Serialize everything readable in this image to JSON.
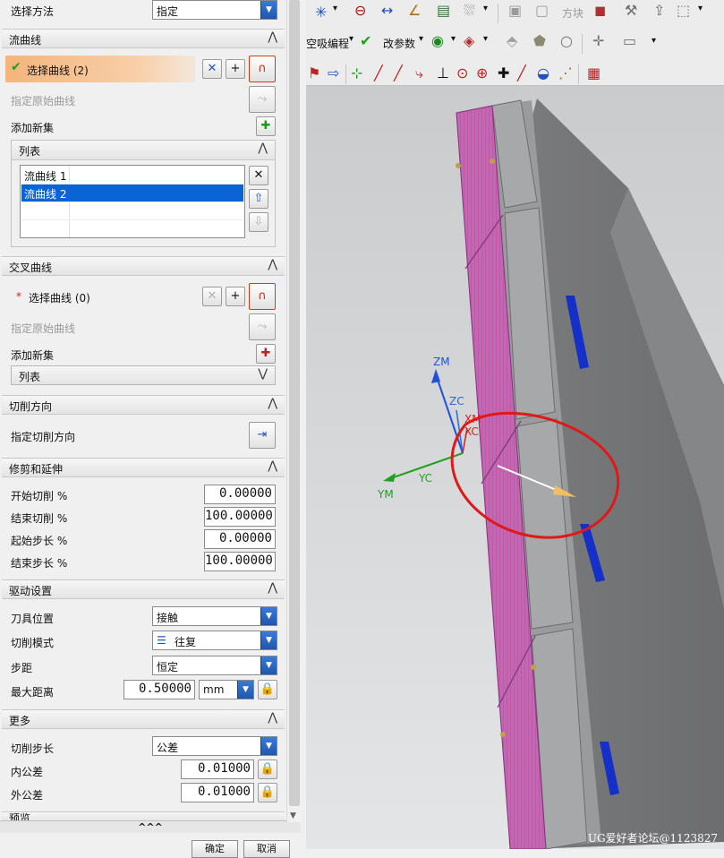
{
  "panel": {
    "method_label": "选择方法",
    "method_value": "指定",
    "streamline": {
      "title": "流曲线",
      "select_curve": "选择曲线 (2)",
      "specify_origin": "指定原始曲线",
      "add_new_set": "添加新集",
      "list_title": "列表",
      "items": [
        "流曲线 1",
        "流曲线 2"
      ]
    },
    "cross": {
      "title": "交叉曲线",
      "select_curve": "选择曲线 (0)",
      "specify_origin": "指定原始曲线",
      "add_new_set": "添加新集",
      "list_title": "列表"
    },
    "cut_dir": {
      "title": "切削方向",
      "specify": "指定切削方向"
    },
    "trim": {
      "title": "修剪和延伸",
      "start_cut_label": "开始切削 %",
      "start_cut": "0.00000",
      "end_cut_label": "结束切削 %",
      "end_cut": "100.00000",
      "start_step_label": "起始步长 %",
      "start_step": "0.00000",
      "end_step_label": "结束步长 %",
      "end_step": "100.00000"
    },
    "drive": {
      "title": "驱动设置",
      "tool_pos_label": "刀具位置",
      "tool_pos": "接触",
      "cut_pattern_label": "切削模式",
      "cut_pattern": "往复",
      "stepover_label": "步距",
      "stepover": "恒定",
      "max_dist_label": "最大距离",
      "max_dist": "0.50000",
      "unit": "mm"
    },
    "more": {
      "title": "更多",
      "cut_step_label": "切削步长",
      "cut_step": "公差",
      "in_tol_label": "内公差",
      "in_tol": "0.01000",
      "out_tol_label": "外公差",
      "out_tol": "0.01000"
    },
    "preview_title": "预览",
    "expand_arrows": "^^^",
    "ok": "确定",
    "cancel": "取消"
  },
  "toolbar": {
    "block_label": "方块",
    "prog_label": "空吸编程",
    "change_param_label": "改参数"
  },
  "viewport": {
    "axes": {
      "zm": "ZM",
      "zc": "ZC",
      "xm": "XM",
      "xc": "XC",
      "yc": "YC",
      "ym": "YM"
    },
    "watermark": "UG爱好者论坛@1123827"
  }
}
